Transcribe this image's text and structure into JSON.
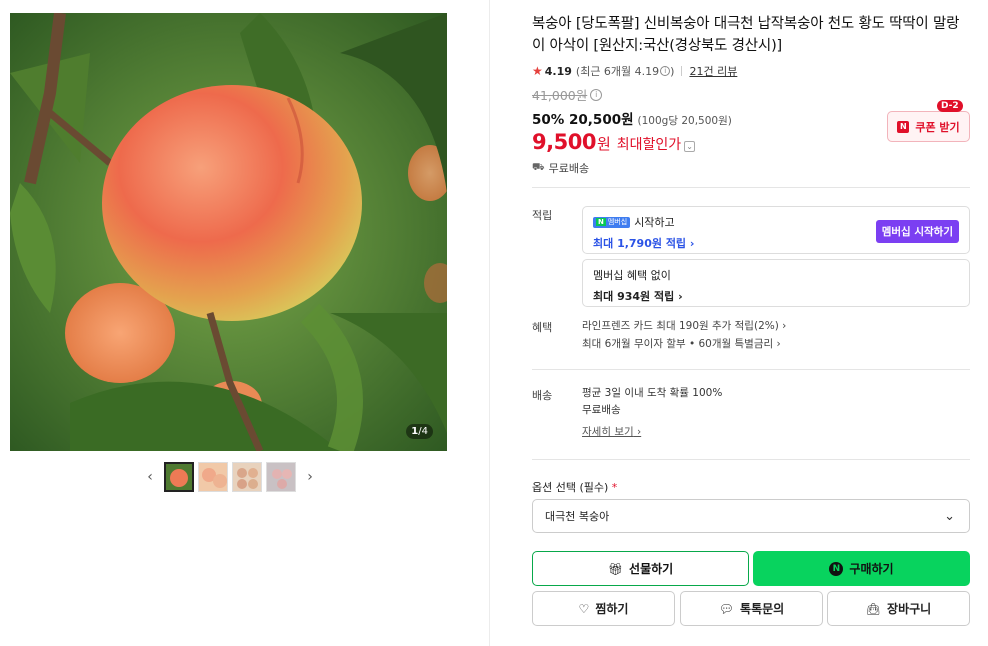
{
  "gallery": {
    "page_current": "1",
    "page_total": "/4",
    "prev_arrow": "‹",
    "next_arrow": "›"
  },
  "product": {
    "title": "복숭아 [당도폭팔] 신비복숭아 대극천 납작복숭아 천도 황도 딱딱이 말랑이 아삭이 [원산지:국산(경상북도 경산시)]",
    "rating_score": "4.19",
    "rating_recent": "(최근 6개월 4.19",
    "rating_close": ")",
    "reviews": "21건 리뷰",
    "original_price": "41,000원",
    "sale_percent_price": "50% 20,500원",
    "unit_price": "(100g당 20,500원)",
    "max_discount_price": "9,500",
    "max_discount_won": "원",
    "max_discount_label": "최대할인가",
    "free_shipping": "무료배송"
  },
  "coupon": {
    "dday": "D-2",
    "label": "쿠폰 받기",
    "logo": "N"
  },
  "points": {
    "label": "적립",
    "membership_badge_n": "N",
    "membership_badge_text": "멤버십",
    "membership_start_text": "시작하고",
    "membership_max": "최대 1,790원 적립",
    "membership_button": "멤버십 시작하기",
    "no_member_title": "멤버십 혜택 없이",
    "no_member_max": "최대 934원 적립"
  },
  "benefits": {
    "label": "혜택",
    "items": [
      "라인프렌즈 카드 최대 190원 추가 적립(2%)",
      "최대 6개월 무이자 할부 • 60개월 특별금리"
    ]
  },
  "delivery": {
    "label": "배송",
    "line1": "평균 3일 이내 도착 확률 100%",
    "line2": "무료배송",
    "more": "자세히 보기"
  },
  "options": {
    "label": "옵션 선택 (필수)",
    "required_mark": "*",
    "selected": "대극천 복숭아"
  },
  "actions": {
    "gift": "선물하기",
    "buy": "구매하기",
    "wish": "찜하기",
    "talk": "톡톡문의",
    "cart": "장바구니"
  }
}
